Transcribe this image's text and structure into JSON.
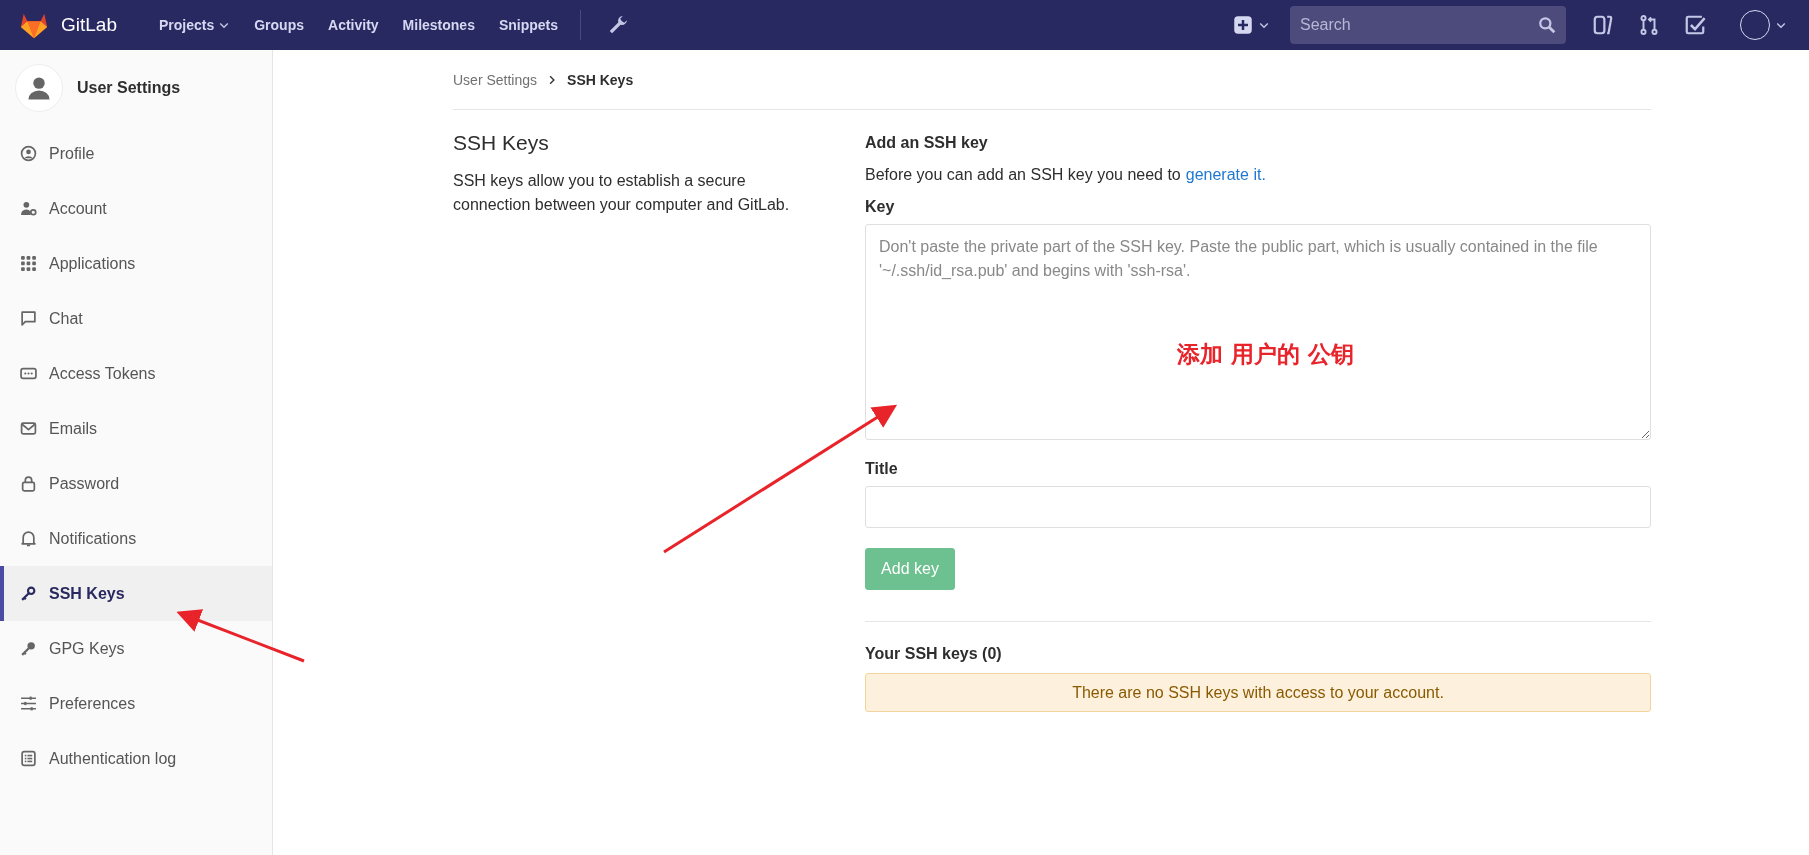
{
  "navbar": {
    "brand": "GitLab",
    "links": [
      {
        "label": "Projects",
        "dropdown": true
      },
      {
        "label": "Groups",
        "dropdown": false
      },
      {
        "label": "Activity",
        "dropdown": false
      },
      {
        "label": "Milestones",
        "dropdown": false
      },
      {
        "label": "Snippets",
        "dropdown": false
      }
    ],
    "search": {
      "placeholder": "Search"
    }
  },
  "sidebar": {
    "title": "User Settings",
    "items": [
      {
        "label": "Profile",
        "kind": "profile",
        "selected": false
      },
      {
        "label": "Account",
        "kind": "account",
        "selected": false
      },
      {
        "label": "Applications",
        "kind": "applications",
        "selected": false
      },
      {
        "label": "Chat",
        "kind": "chat",
        "selected": false
      },
      {
        "label": "Access Tokens",
        "kind": "token",
        "selected": false
      },
      {
        "label": "Emails",
        "kind": "email",
        "selected": false
      },
      {
        "label": "Password",
        "kind": "lock",
        "selected": false
      },
      {
        "label": "Notifications",
        "kind": "bell",
        "selected": false
      },
      {
        "label": "SSH Keys",
        "kind": "key",
        "selected": true
      },
      {
        "label": "GPG Keys",
        "kind": "gpg",
        "selected": false
      },
      {
        "label": "Preferences",
        "kind": "sliders",
        "selected": false
      },
      {
        "label": "Authentication log",
        "kind": "log",
        "selected": false
      }
    ]
  },
  "breadcrumb": [
    "User Settings",
    "SSH Keys"
  ],
  "intro": {
    "title": "SSH Keys",
    "text": "SSH keys allow you to establish a secure connection between your computer and GitLab."
  },
  "form": {
    "heading": "Add an SSH key",
    "hint": "Before you can add an SSH key you need to",
    "hint_link": "generate it.",
    "key_label": "Key",
    "key_placeholder": "Don't paste the private part of the SSH key. Paste the public part, which is usually contained in the file '~/.ssh/id_rsa.pub' and begins with 'ssh-rsa'.",
    "title_label": "Title",
    "submit": "Add key",
    "submit_disabled": true
  },
  "keys": {
    "heading": "Your SSH keys (0)",
    "empty_message": "There are no SSH keys with access to your account."
  },
  "annotation": {
    "text": "添加 用户的 公钥"
  }
}
